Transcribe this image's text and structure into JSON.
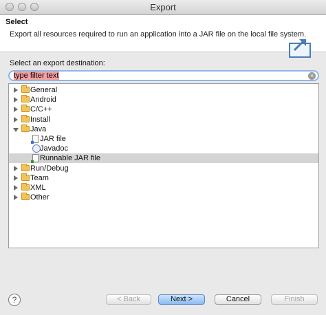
{
  "window": {
    "title": "Export"
  },
  "header": {
    "title": "Select",
    "description": "Export all resources required to run an application into a JAR file on the local file system."
  },
  "destination_label": "Select an export destination:",
  "filter": {
    "value": "type filter text",
    "clear_icon": "×"
  },
  "tree": {
    "items": [
      {
        "label": "General",
        "kind": "folder",
        "expanded": false,
        "level": 0
      },
      {
        "label": "Android",
        "kind": "folder",
        "expanded": false,
        "level": 0
      },
      {
        "label": "C/C++",
        "kind": "folder",
        "expanded": false,
        "level": 0
      },
      {
        "label": "Install",
        "kind": "folder",
        "expanded": false,
        "level": 0
      },
      {
        "label": "Java",
        "kind": "folder",
        "expanded": true,
        "level": 0
      },
      {
        "label": "JAR file",
        "kind": "jar",
        "level": 1
      },
      {
        "label": "Javadoc",
        "kind": "javadoc",
        "level": 1
      },
      {
        "label": "Runnable JAR file",
        "kind": "runnable-jar",
        "level": 1,
        "selected": true
      },
      {
        "label": "Run/Debug",
        "kind": "folder",
        "expanded": false,
        "level": 0
      },
      {
        "label": "Team",
        "kind": "folder",
        "expanded": false,
        "level": 0
      },
      {
        "label": "XML",
        "kind": "folder",
        "expanded": false,
        "level": 0
      },
      {
        "label": "Other",
        "kind": "folder",
        "expanded": false,
        "level": 0
      }
    ]
  },
  "footer": {
    "help": "?",
    "back": "< Back",
    "next": "Next >",
    "cancel": "Cancel",
    "finish": "Finish"
  },
  "colors": {
    "default_button": "#8bbcf3",
    "selection": "#d4d4d4",
    "filter_highlight": "#f3a0a0"
  }
}
